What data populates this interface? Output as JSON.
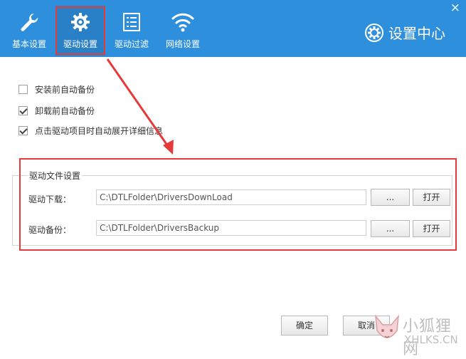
{
  "window": {
    "close_glyph": "×"
  },
  "nav": [
    {
      "label": "基本设置",
      "icon": "wrench-icon",
      "active": false
    },
    {
      "label": "驱动设置",
      "icon": "gear-icon",
      "active": true
    },
    {
      "label": "驱动过滤",
      "icon": "list-icon",
      "active": false
    },
    {
      "label": "网络设置",
      "icon": "wifi-icon",
      "active": false
    }
  ],
  "brand": {
    "title": "设置中心",
    "icon": "settings-gear-icon"
  },
  "options": [
    {
      "label": "安装前自动备份",
      "checked": false
    },
    {
      "label": "卸载前自动备份",
      "checked": true
    },
    {
      "label": "点击驱动项目时自动展开详细信息",
      "checked": true
    }
  ],
  "driver_files": {
    "title": "驱动文件设置",
    "download": {
      "label": "驱动下载：",
      "path": "C:\\DTLFolder\\DriversDownLoad",
      "browse": "...",
      "open": "打开"
    },
    "backup": {
      "label": "驱动备份：",
      "path": "C:\\DTLFolder\\DriversBackup",
      "browse": "...",
      "open": "打开"
    }
  },
  "footer": {
    "ok": "确定",
    "cancel": "取消"
  },
  "watermark": {
    "line1": "小狐狸网",
    "line2": "XHLKS.CN"
  },
  "colors": {
    "header": "#2e8fdd",
    "highlight": "#e43a3a"
  }
}
